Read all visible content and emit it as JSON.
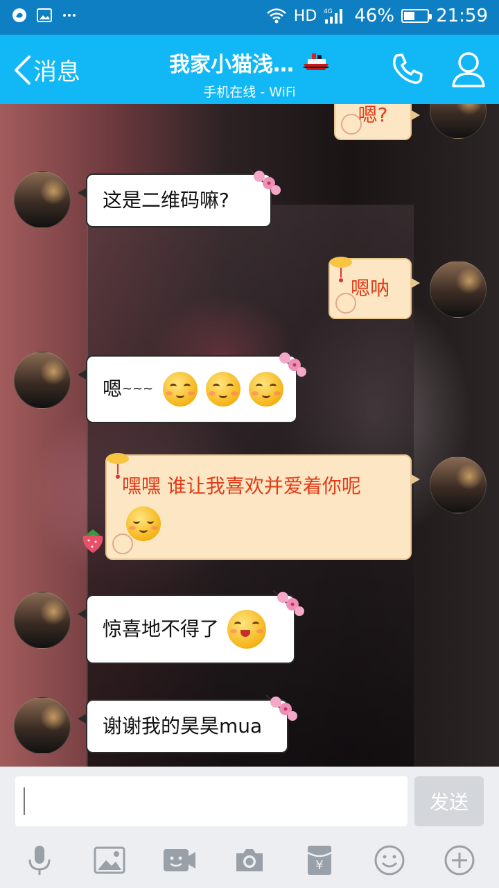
{
  "status_bar": {
    "network_label": "HD",
    "network_type": "4G",
    "battery_percent": "46%",
    "battery_level": 0.46,
    "time": "21:59"
  },
  "title_bar": {
    "back_label": "消息",
    "contact_name": "我家小猫浅…",
    "contact_status": "手机在线 - WiFi",
    "icons": [
      "ship-icon",
      "phone-icon",
      "profile-icon"
    ]
  },
  "messages": [
    {
      "side": "out",
      "text": "嗯?"
    },
    {
      "side": "in",
      "text": "这是二维码嘛?"
    },
    {
      "side": "out",
      "text": "嗯呐"
    },
    {
      "side": "in",
      "text": "嗯",
      "tilde": "~~~",
      "emoji_count": 3
    },
    {
      "side": "out",
      "text": "嘿嘿 谁让我喜欢并爱着你呢",
      "emoji_count": 1
    },
    {
      "side": "in",
      "text": "惊喜地不得了",
      "emoji_count": 1
    },
    {
      "side": "in",
      "text": "谢谢我的昊昊mua"
    }
  ],
  "input": {
    "placeholder": "",
    "value": "",
    "send_label": "发送"
  },
  "toolbar_icons": [
    "microphone-icon",
    "image-icon",
    "video-call-icon",
    "camera-icon",
    "red-packet-icon",
    "emoji-icon",
    "plus-icon"
  ],
  "colors": {
    "status_bar": "#0f7fc3",
    "title_bar": "#12b7f5",
    "outgoing_bubble": "#fde6c4",
    "outgoing_text": "#e23b17",
    "incoming_bubble": "#ffffff",
    "input_bg": "#eceef1"
  }
}
